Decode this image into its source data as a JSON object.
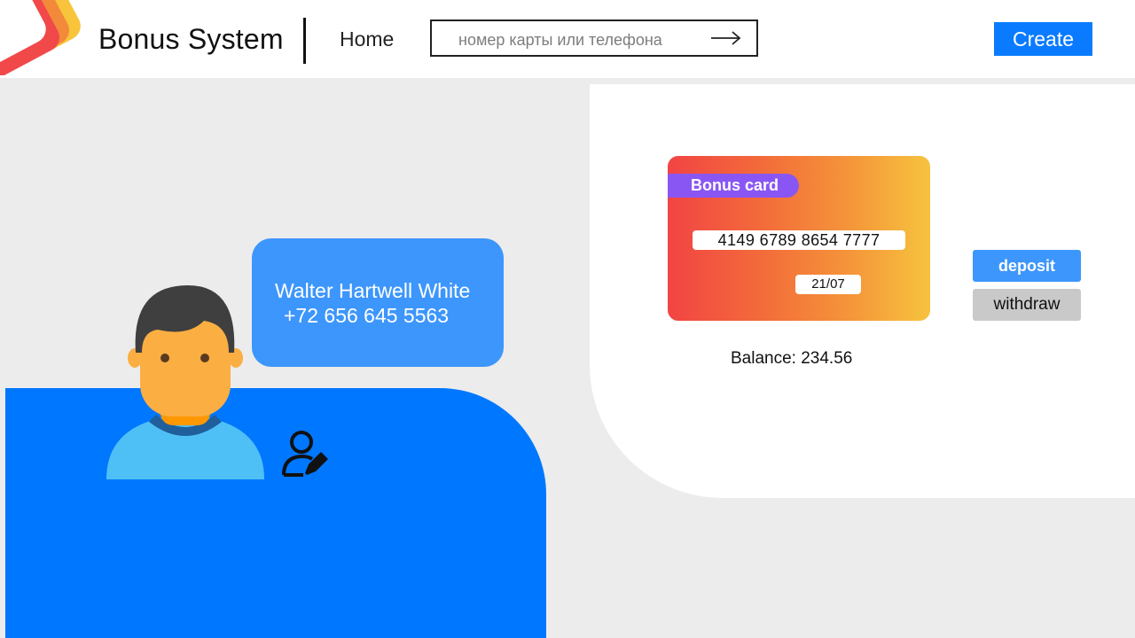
{
  "header": {
    "brand": "Bonus System",
    "nav_home": "Home",
    "search_placeholder": "номер карты или телефона",
    "create_label": "Create"
  },
  "customer": {
    "name": "Walter Hartwell White",
    "phone": "+72 656 645 5563"
  },
  "card": {
    "tag": "Bonus card",
    "number": "4149 6789 8654 7777",
    "expiry": "21/07"
  },
  "balance": {
    "label": "Balance:",
    "value": "234.56"
  },
  "actions": {
    "deposit": "deposit",
    "withdraw": "withdraw"
  },
  "colors": {
    "accent": "#0a7bff",
    "panel_blue": "#0077ff",
    "bubble_blue": "#3d96fb",
    "card_tag": "#8a56f3",
    "card_gradient_start": "#f24444",
    "card_gradient_end": "#f6c33e"
  },
  "icons": {
    "logo": "layered-logo-icon",
    "search_submit": "arrow-right-icon",
    "avatar": "user-avatar-icon",
    "edit_user": "user-edit-icon"
  }
}
